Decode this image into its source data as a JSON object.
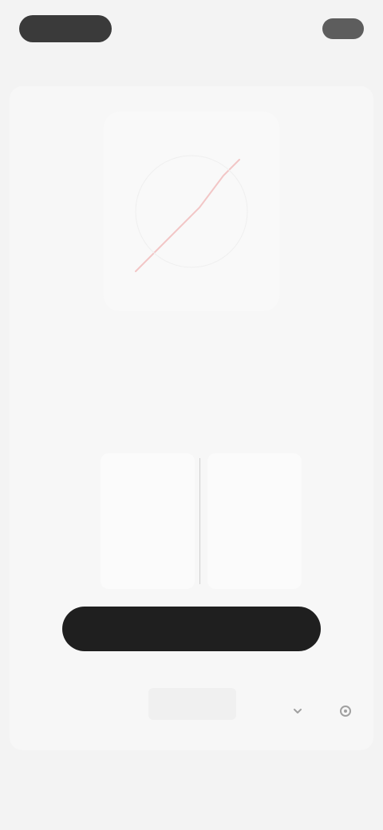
{
  "header": {
    "brand": "",
    "link": "",
    "action": ""
  },
  "hero": {
    "accent": "#f2c6c6"
  },
  "headline": "",
  "cta": {
    "label": ""
  },
  "mini_icons": [
    "chevron-icon",
    "settings-icon"
  ],
  "nav": {
    "items": [
      {
        "label": "",
        "active": true
      },
      {
        "label": ""
      },
      {
        "label": ""
      },
      {
        "label": ""
      }
    ]
  },
  "colors": {
    "background": "#f3f3f3",
    "card": "#f7f7f7",
    "cta": "#1f1f1f",
    "brand_pill": "#3a3a3a"
  }
}
